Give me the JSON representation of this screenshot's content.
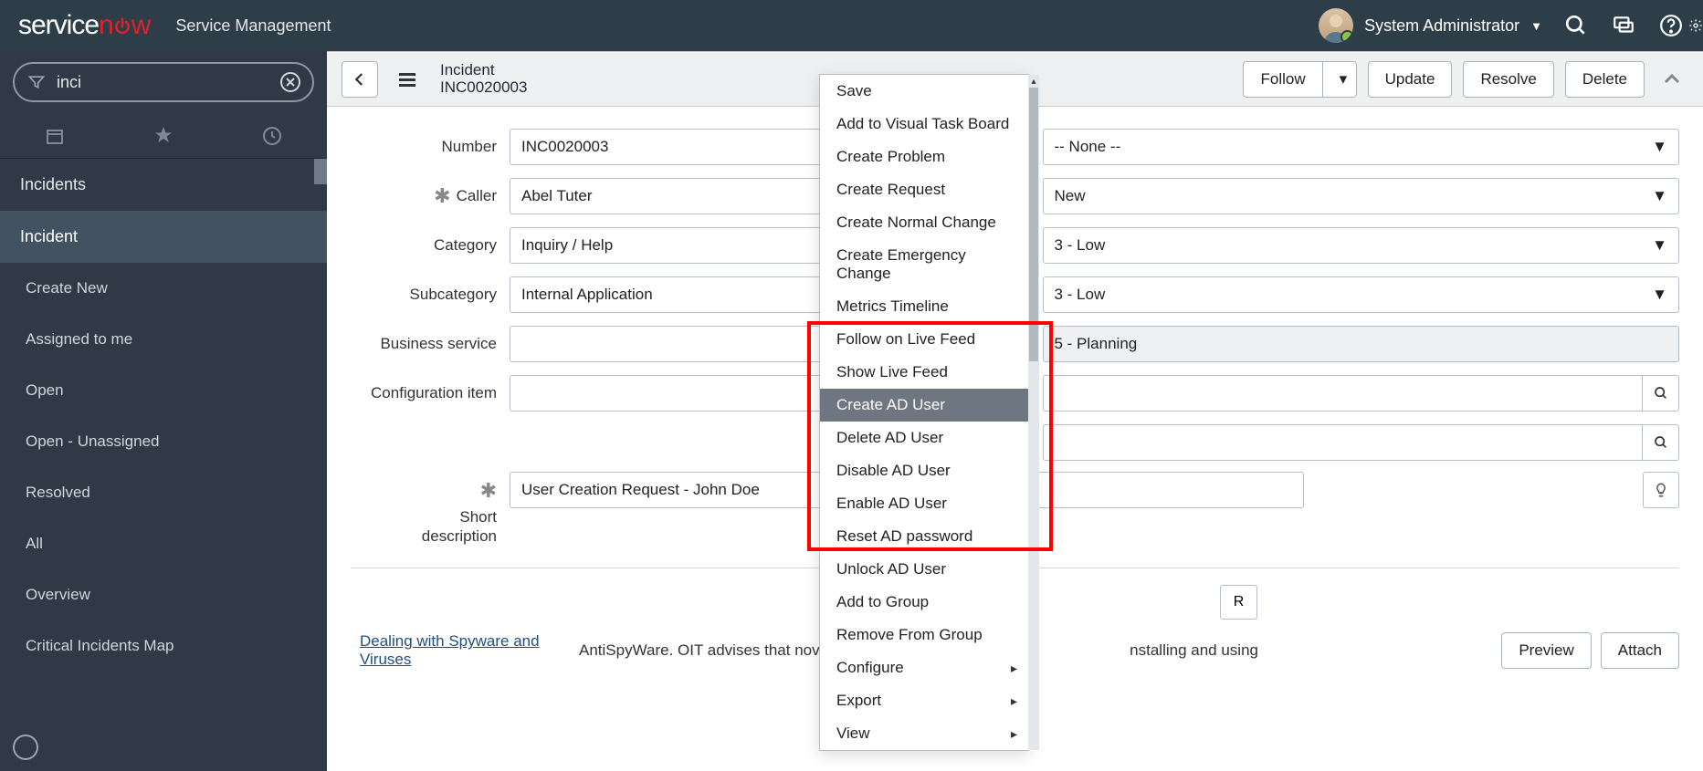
{
  "header": {
    "logo_main": "service",
    "logo_accent": "now",
    "app_name": "Service Management",
    "user_name": "System Administrator"
  },
  "nav": {
    "search_value": "inci",
    "items": [
      {
        "label": "Incidents",
        "type": "heading"
      },
      {
        "label": "Incident",
        "type": "active"
      },
      {
        "label": "Create New",
        "type": "sub"
      },
      {
        "label": "Assigned to me",
        "type": "sub"
      },
      {
        "label": "Open",
        "type": "sub"
      },
      {
        "label": "Open - Unassigned",
        "type": "sub"
      },
      {
        "label": "Resolved",
        "type": "sub"
      },
      {
        "label": "All",
        "type": "sub"
      },
      {
        "label": "Overview",
        "type": "sub"
      },
      {
        "label": "Critical Incidents Map",
        "type": "sub"
      }
    ]
  },
  "form_header": {
    "title": "Incident",
    "number": "INC0020003",
    "buttons": {
      "follow": "Follow",
      "update": "Update",
      "resolve": "Resolve",
      "delete": "Delete"
    }
  },
  "left_fields": {
    "number": {
      "label": "Number",
      "value": "INC0020003"
    },
    "caller": {
      "label": "Caller",
      "value": "Abel Tuter"
    },
    "category": {
      "label": "Category",
      "value": "Inquiry / Help"
    },
    "subcategory": {
      "label": "Subcategory",
      "value": "Internal Application"
    },
    "business_service": {
      "label": "Business service",
      "value": ""
    },
    "config_item": {
      "label": "Configuration item",
      "value": ""
    }
  },
  "right_fields": {
    "f1": {
      "value": "-- None --"
    },
    "f2": {
      "value": "New"
    },
    "f3": {
      "value": "3 - Low"
    },
    "f4": {
      "value": "3 - Low"
    },
    "f5": {
      "value": "5 - Planning"
    },
    "f6": {
      "value": ""
    },
    "f7": {
      "value": ""
    }
  },
  "short_desc": {
    "label": "Short description",
    "value": "User Creation Request - John Doe"
  },
  "related": {
    "button_partial": "R",
    "link": "Dealing with Spyware and Viruses",
    "text_left": "AntiSpyWare. OIT advises that novice user",
    "text_right": "nstalling and using",
    "preview": "Preview",
    "attach": "Attach"
  },
  "context_menu": [
    {
      "label": "Save"
    },
    {
      "label": "Add to Visual Task Board"
    },
    {
      "label": "Create Problem"
    },
    {
      "label": "Create Request"
    },
    {
      "label": "Create Normal Change"
    },
    {
      "label": "Create Emergency Change"
    },
    {
      "label": "Metrics Timeline"
    },
    {
      "label": "Follow on Live Feed"
    },
    {
      "label": "Show Live Feed"
    },
    {
      "label": "Create AD User",
      "highlighted": true
    },
    {
      "label": "Delete AD User"
    },
    {
      "label": "Disable AD User"
    },
    {
      "label": "Enable AD User"
    },
    {
      "label": "Reset AD password"
    },
    {
      "label": "Unlock AD User"
    },
    {
      "label": "Add to Group"
    },
    {
      "label": "Remove From Group"
    },
    {
      "label": "Configure",
      "sub": true
    },
    {
      "label": "Export",
      "sub": true
    },
    {
      "label": "View",
      "sub": true
    }
  ]
}
